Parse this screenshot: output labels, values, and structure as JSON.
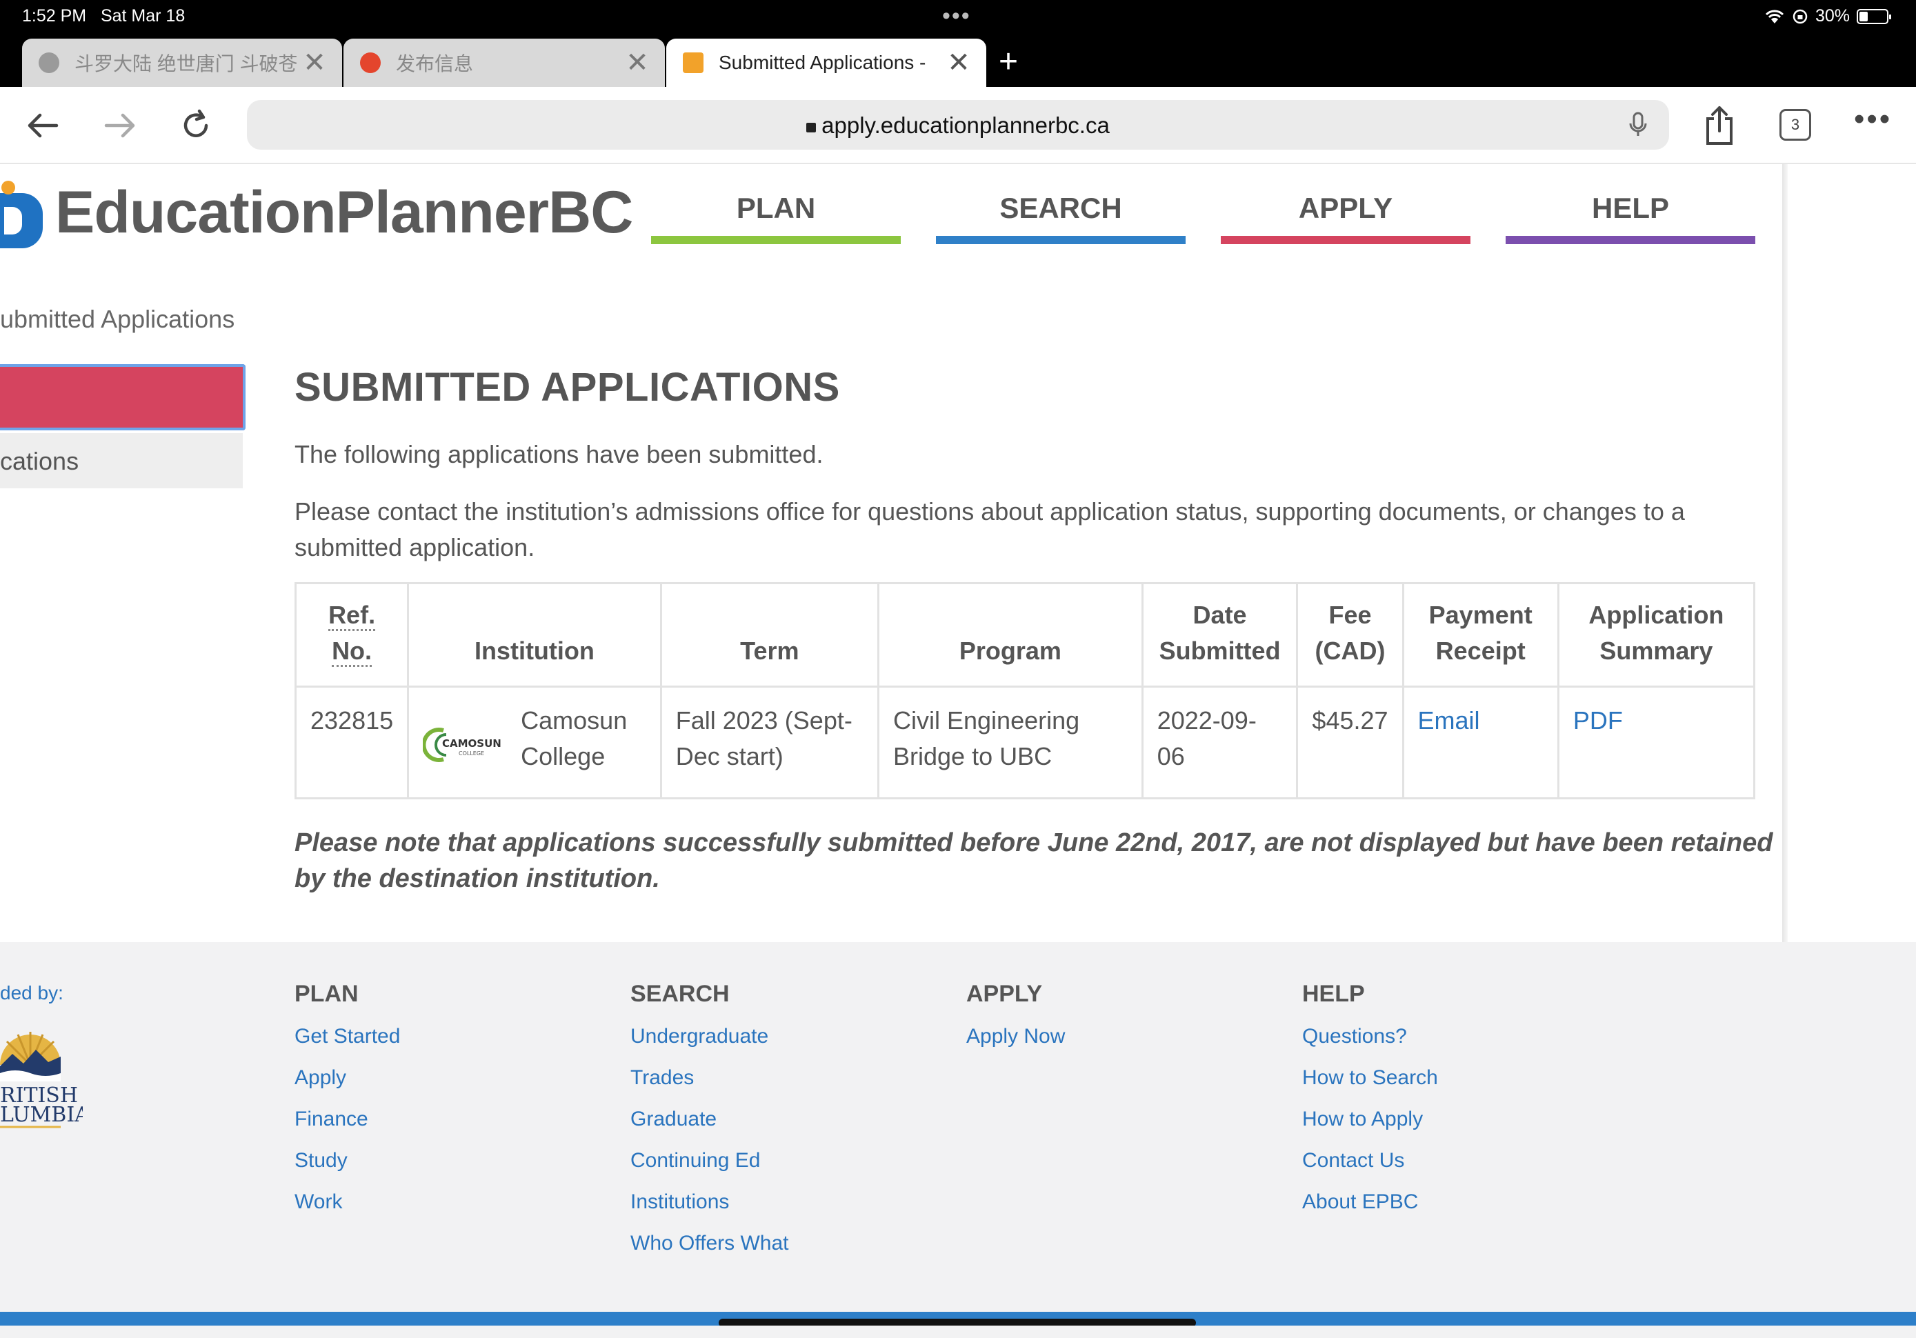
{
  "status": {
    "time": "1:52 PM",
    "date": "Sat Mar 18",
    "battery": "30%"
  },
  "tabs": [
    {
      "title": "斗罗大陆 绝世唐门 斗破苍"
    },
    {
      "title": "发布信息"
    },
    {
      "title": "Submitted Applications -"
    }
  ],
  "toolbar": {
    "url": "apply.educationplannerbc.ca",
    "tab_count": "3"
  },
  "site": {
    "logo": "EducationPlannerBC",
    "nav": [
      {
        "label": "PLAN",
        "color": "#8cc63f"
      },
      {
        "label": "SEARCH",
        "color": "#2f80c8"
      },
      {
        "label": "APPLY",
        "color": "#d5445f"
      },
      {
        "label": "HELP",
        "color": "#7b4fae"
      }
    ],
    "breadcrumb": "ubmitted Applications",
    "sidebar_item": "cations"
  },
  "main": {
    "heading": "SUBMITTED APPLICATIONS",
    "intro": "The following applications have been submitted.",
    "contact": "Please contact the institution’s admissions office for questions about application status, supporting documents, or changes to a submitted application.",
    "note": "Please note that applications successfully submitted before June 22nd, 2017, are not displayed but have been retained by the destination institution."
  },
  "table": {
    "headers": {
      "ref_1": "Ref.",
      "ref_2": "No.",
      "institution": "Institution",
      "term": "Term",
      "program": "Program",
      "date_1": "Date",
      "date_2": "Submitted",
      "fee_1": "Fee",
      "fee_2": "(CAD)",
      "pay_1": "Payment",
      "pay_2": "Receipt",
      "sum_1": "Application",
      "sum_2": "Summary"
    },
    "row": {
      "ref": "232815",
      "institution_1": "Camosun",
      "institution_2": "College",
      "institution_logo_text": "CAMOSUN",
      "institution_logo_sub": "COLLEGE",
      "term_1": "Fall 2023 (Sept-",
      "term_2": "Dec start)",
      "program_1": "Civil Engineering",
      "program_2": "Bridge to UBC",
      "date_1": "2022-09-",
      "date_2": "06",
      "fee": "$45.27",
      "receipt": "Email",
      "summary": "PDF"
    }
  },
  "footer": {
    "funded": "ded by:",
    "bc_1": "RITISH",
    "bc_2": "LUMBIA",
    "cols": [
      {
        "title": "PLAN",
        "links": [
          "Get Started",
          "Apply",
          "Finance",
          "Study",
          "Work"
        ]
      },
      {
        "title": "SEARCH",
        "links": [
          "Undergraduate",
          "Trades",
          "Graduate",
          "Continuing Ed",
          "Institutions",
          "Who Offers What"
        ]
      },
      {
        "title": "APPLY",
        "links": [
          "Apply Now"
        ]
      },
      {
        "title": "HELP",
        "links": [
          "Questions?",
          "How to Search",
          "How to Apply",
          "Contact Us",
          "About EPBC"
        ]
      }
    ]
  }
}
